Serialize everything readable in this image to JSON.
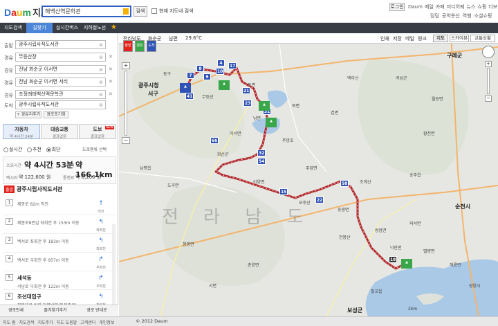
{
  "header": {
    "logo_letters": [
      "D",
      "a",
      "u",
      "m"
    ],
    "service_name": "지도",
    "search_value": "해백산역문학관",
    "search_button": "검색",
    "checkbox_label": "현재 지도내 검색",
    "login": "로그인",
    "topnav": [
      "Daum",
      "메일",
      "카페",
      "미디어퀘",
      "뉴스",
      "쇼핑",
      "더보기"
    ],
    "subnav": [
      "덤덤",
      "공약옷산",
      "역행",
      "소셜쇼핑"
    ]
  },
  "toolbar": {
    "tabs": [
      "지도검색",
      "길찾기",
      "실시간버스",
      "지하철노선"
    ],
    "active_tab": "길찾기"
  },
  "panel": {
    "waypoints": [
      {
        "label": "출발",
        "value": "광주시립사직도서관"
      },
      {
        "label": "경유",
        "value": "무등산장"
      },
      {
        "label": "경유",
        "value": "전남 화순군 이서면"
      },
      {
        "label": "경유",
        "value": "전남 화순군 이서면 서리"
      },
      {
        "label": "경유",
        "value": "조정래태백산맥문학관"
      },
      {
        "label": "도착",
        "value": "광주시립사직도서관"
      }
    ],
    "add_waypoint": "+ 경유지추가",
    "reset": "경로초기화",
    "modes": [
      {
        "title": "자동차",
        "sub": "약 4시간 24분"
      },
      {
        "title": "대중교통",
        "sub": "결과없음"
      },
      {
        "title": "도보",
        "sub": "결과없음",
        "badge": "NEW"
      }
    ],
    "radio": [
      "실시간",
      "추천",
      "최단"
    ],
    "radio_selected": "최단",
    "radio_note": "도로종류 선택",
    "stats": {
      "time_label": "소요시간",
      "time_value": "약 4시간 53분",
      "dist_label": "총거리",
      "dist_value": "약 166.1km",
      "taxi_label": "택시비",
      "taxi_value": "약 122,600 원",
      "fuel_label": "통행료",
      "fuel_value": "약 6,200 원"
    },
    "route_title": "광주시립사직도서관",
    "start_badge": "출발",
    "steps": [
      {
        "num": "1",
        "title": "",
        "text": "제봉로 82m 직진",
        "dir": "↑",
        "dir_label": "직진"
      },
      {
        "num": "2",
        "title": "",
        "text": "제봉로8번길 좌회전 후 153m 이동",
        "dir": "↰",
        "dir_label": "좌회전"
      },
      {
        "num": "3",
        "title": "",
        "text": "백서로 좌회전 후 183m 이동",
        "dir": "↰",
        "dir_label": "좌회전"
      },
      {
        "num": "4",
        "title": "",
        "text": "백서로 우회전 후 957m 이동",
        "dir": "↱",
        "dir_label": "우회전"
      },
      {
        "num": "5",
        "title": "세석동",
        "text": "서남로 우회전 후 122m 이동",
        "dir": "↱",
        "dir_label": "우회전"
      },
      {
        "num": "6",
        "title": "조선대입구",
        "text": "필문대로 방향 천봉방향(동문주로)",
        "dir": "↰",
        "dir_label": "좌회전"
      }
    ],
    "actions": [
      "경로인쇄",
      "즐겨찾기추가",
      "경로 반대로"
    ]
  },
  "map": {
    "weather": "29.6°C",
    "location_path": [
      "전라남도",
      "화순군",
      "남면"
    ],
    "view_options": [
      "인쇄",
      "저장",
      "메일",
      "링크",
      "지도",
      "스카이뷰",
      "교통상황"
    ],
    "active_view": "지도",
    "flags": [
      "출발",
      "경유",
      "도착"
    ],
    "region_text": "전 라 남 도",
    "city_labels": [
      "광주시청",
      "서구",
      "순천시",
      "보성군",
      "구례군",
      "동구"
    ],
    "place_labels": [
      "무등산",
      "곡성군",
      "화순군",
      "주암호",
      "송광면",
      "낙안면",
      "벌교읍",
      "승주읍",
      "월등면",
      "황전면",
      "남면",
      "이서면",
      "북면",
      "주암면",
      "외서면",
      "쌍암면",
      "동면",
      "이양면",
      "청풍면",
      "남평읍",
      "도곡면",
      "춘양면",
      "겸면",
      "서면",
      "별량면",
      "조계산",
      "천봉산",
      "백아산",
      "모후산",
      "광양시",
      "해룡면"
    ],
    "route_badges": [
      "7",
      "8",
      "9",
      "10",
      "4",
      "17",
      "21",
      "23",
      "31",
      "24",
      "41",
      "66",
      "32",
      "54",
      "15",
      "58",
      "22",
      "18"
    ],
    "scale": "2km",
    "zoom_labels": [
      "+",
      "−"
    ]
  },
  "footer": {
    "links": [
      "지도 홈",
      "지도검색",
      "지도주가",
      "지도 도움말",
      "고객센터",
      "개인정보"
    ],
    "copyright": "© 2012 Daum"
  }
}
